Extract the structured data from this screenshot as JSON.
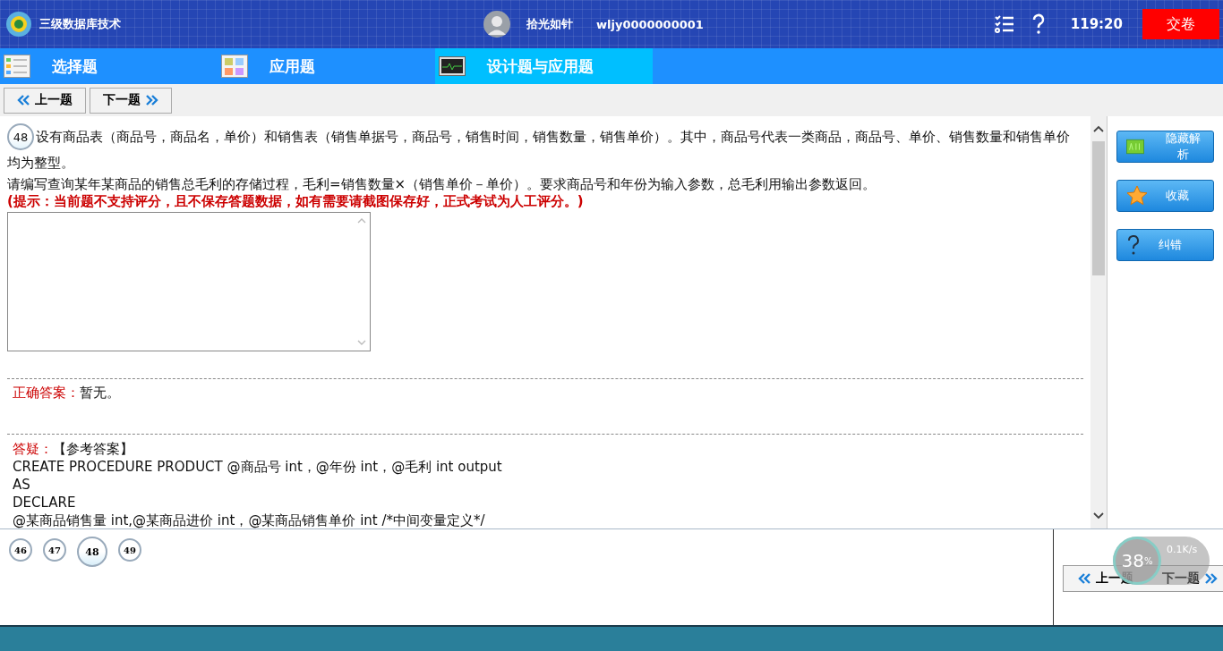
{
  "header": {
    "title": "三级数据库技术",
    "user_name": "拾光如针",
    "user_id": "wljy0000000001",
    "timer": "119:20",
    "submit_button": "交卷"
  },
  "tabs": [
    {
      "label": "选择题",
      "selected": false
    },
    {
      "label": "应用题",
      "selected": false
    },
    {
      "label": "设计题与应用题",
      "selected": true
    }
  ],
  "nav_top": {
    "prev": "上一题",
    "next": "下一题"
  },
  "question": {
    "number": "48",
    "text_1": "设有商品表（商品号，商品名，单价）和销售表（销售单据号，商品号，销售时间，销售数量，销售单价）。其中，商品号代表一类商品，商品号、单价、销售数量和销售单价均为整型。",
    "text_2": "请编写查询某年某商品的销售总毛利的存储过程，毛利=销售数量×（销售单价－单价）。要求商品号和年份为输入参数，总毛利用输出参数返回。",
    "hint": "(提示：当前题不支持评分，且不保存答题数据，如有需要请截图保存好，正式考试为人工评分。)"
  },
  "correct_answer": {
    "label": "正确答案：",
    "value": "暂无。"
  },
  "explanation": {
    "label": "答疑：",
    "title": "【参考答案】",
    "lines": [
      "CREATE PROCEDURE PRODUCT @商品号 int，@年份 int，@毛利 int output",
      "AS",
      "DECLARE",
      "@某商品销售量 int,@某商品进价 int，@某商品销售单价 int  /*中间变量定义*/"
    ]
  },
  "side_buttons": [
    {
      "label": "隐藏解析"
    },
    {
      "label": "收藏"
    },
    {
      "label": "纠错"
    }
  ],
  "answer_card": [
    {
      "number": "46",
      "selected": false
    },
    {
      "number": "47",
      "selected": false
    },
    {
      "number": "48",
      "selected": true
    },
    {
      "number": "49",
      "selected": false
    }
  ],
  "nav_bottom": {
    "prev": "上一题",
    "next": "下一题"
  },
  "speed_widget": {
    "percent": "38",
    "percent_sign": "%",
    "speed": "0.1K/s"
  }
}
